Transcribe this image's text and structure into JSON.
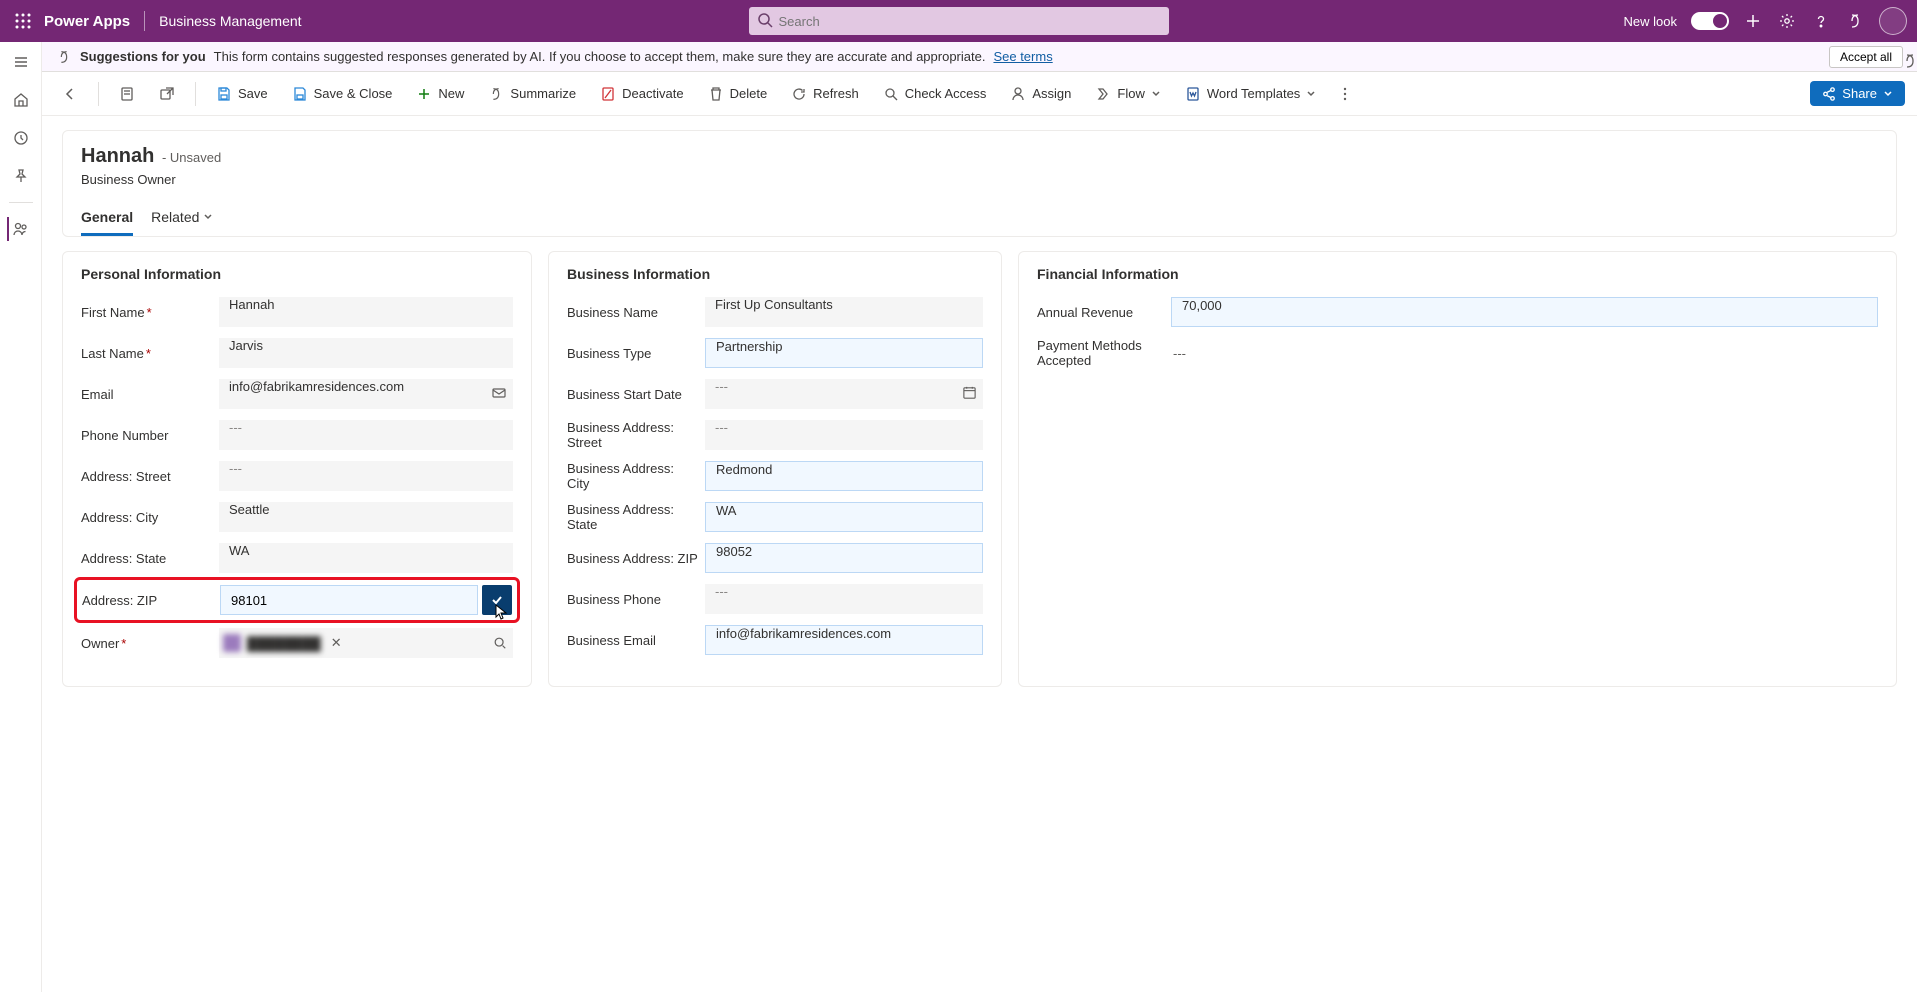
{
  "topbar": {
    "brand": "Power Apps",
    "appname": "Business Management",
    "search_placeholder": "Search",
    "new_look_label": "New look"
  },
  "suggestion_bar": {
    "bold": "Suggestions for you",
    "text": " This form contains suggested responses generated by AI. If you choose to accept them, make sure they are accurate and appropriate. ",
    "link": "See terms",
    "accept": "Accept all"
  },
  "commands": {
    "save": "Save",
    "save_close": "Save & Close",
    "new": "New",
    "summarize": "Summarize",
    "deactivate": "Deactivate",
    "delete": "Delete",
    "refresh": "Refresh",
    "check_access": "Check Access",
    "assign": "Assign",
    "flow": "Flow",
    "word_templates": "Word Templates",
    "share": "Share"
  },
  "record": {
    "title": "Hannah",
    "status": "- Unsaved",
    "subtitle": "Business Owner",
    "tabs": {
      "general": "General",
      "related": "Related"
    }
  },
  "personal": {
    "heading": "Personal Information",
    "first_name_label": "First Name",
    "first_name": "Hannah",
    "last_name_label": "Last Name",
    "last_name": "Jarvis",
    "email_label": "Email",
    "email": "info@fabrikamresidences.com",
    "phone_label": "Phone Number",
    "phone": "---",
    "street_label": "Address: Street",
    "street": "---",
    "city_label": "Address: City",
    "city": "Seattle",
    "state_label": "Address: State",
    "state": "WA",
    "zip_label": "Address: ZIP",
    "zip": "98101",
    "owner_label": "Owner",
    "owner": "████████"
  },
  "business": {
    "heading": "Business Information",
    "name_label": "Business Name",
    "name": "First Up Consultants",
    "type_label": "Business Type",
    "type": "Partnership",
    "start_label": "Business Start Date",
    "start": "---",
    "street_label": "Business Address: Street",
    "street": "---",
    "city_label": "Business Address: City",
    "city": "Redmond",
    "state_label": "Business Address: State",
    "state": "WA",
    "zip_label": "Business Address: ZIP",
    "zip": "98052",
    "phone_label": "Business Phone",
    "phone": "---",
    "email_label": "Business Email",
    "email": "info@fabrikamresidences.com"
  },
  "financial": {
    "heading": "Financial Information",
    "revenue_label": "Annual Revenue",
    "revenue": "70,000",
    "payment_label": "Payment Methods Accepted",
    "payment": "---"
  }
}
